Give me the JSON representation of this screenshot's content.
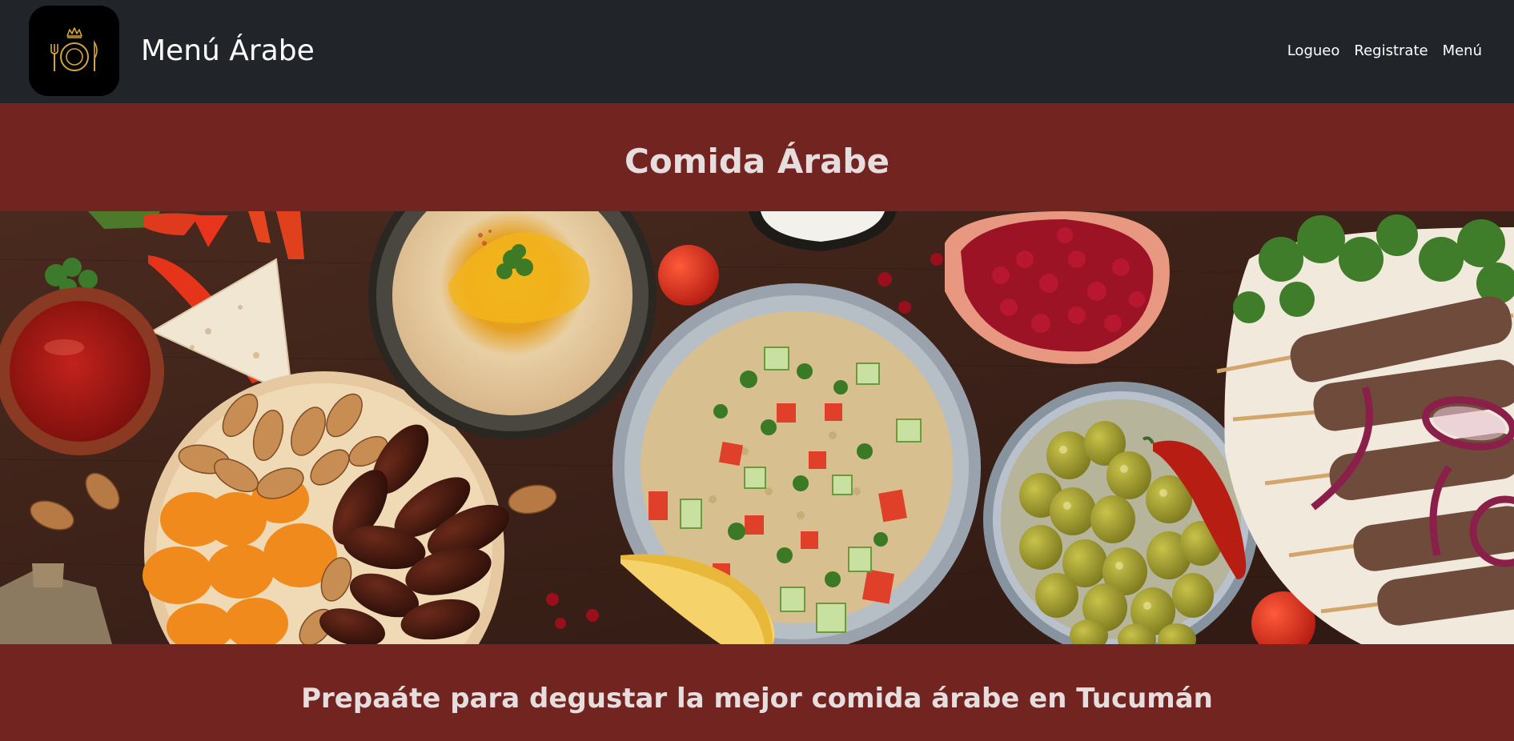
{
  "navbar": {
    "brand_text": "Menú Árabe",
    "logo_icon": "plate-cutlery-crown-icon",
    "links": [
      {
        "label": "Logueo"
      },
      {
        "label": "Registrate"
      },
      {
        "label": "Menú"
      }
    ]
  },
  "hero": {
    "title": "Comida Árabe",
    "image_alt": "arabic-food-spread",
    "subtitle": "Prepaáte para degustar la mejor comida árabe en Tucumán"
  },
  "colors": {
    "navbar_bg": "#212529",
    "band_bg": "#722520",
    "heading_text": "#e6dede",
    "logo_gold": "#d4a537"
  }
}
